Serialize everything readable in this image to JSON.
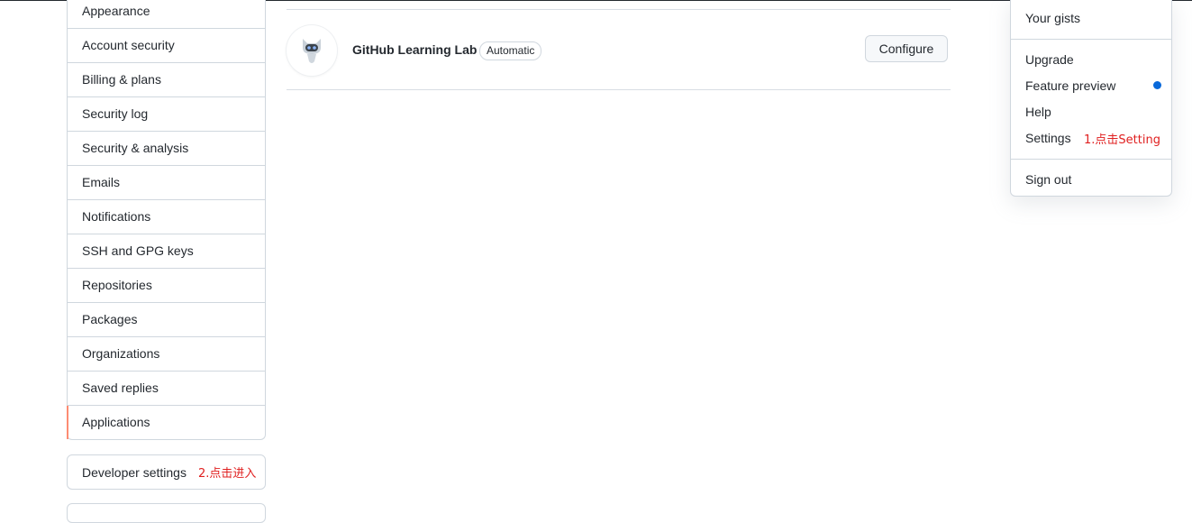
{
  "sidebar": {
    "items": [
      {
        "label": "Appearance"
      },
      {
        "label": "Account security"
      },
      {
        "label": "Billing & plans"
      },
      {
        "label": "Security log"
      },
      {
        "label": "Security & analysis"
      },
      {
        "label": "Emails"
      },
      {
        "label": "Notifications"
      },
      {
        "label": "SSH and GPG keys"
      },
      {
        "label": "Repositories"
      },
      {
        "label": "Packages"
      },
      {
        "label": "Organizations"
      },
      {
        "label": "Saved replies"
      },
      {
        "label": "Applications"
      }
    ],
    "selected": "Applications",
    "developer_settings": "Developer settings",
    "developer_note": "2.点击进入"
  },
  "app": {
    "name": "GitHub Learning Lab",
    "badge": "Automatic",
    "configure_label": "Configure"
  },
  "dropdown": {
    "your_gists": "Your gists",
    "upgrade": "Upgrade",
    "feature_preview": "Feature preview",
    "help": "Help",
    "settings": "Settings",
    "settings_note": "1.点击Setting",
    "sign_out": "Sign out"
  },
  "colors": {
    "accent_selected": "#fd8c73",
    "annotation_red": "#e02020",
    "dot_blue": "#0969da"
  }
}
